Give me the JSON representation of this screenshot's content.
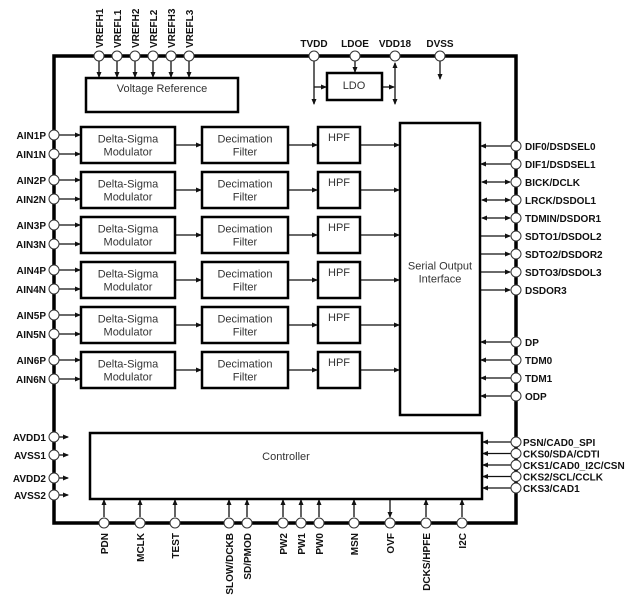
{
  "top_pins": {
    "vref": [
      "VREFH1",
      "VREFL1",
      "VREFH2",
      "VREFL2",
      "VREFH3",
      "VREFL3"
    ],
    "power": [
      "TVDD",
      "LDOE",
      "VDD18",
      "DVSS"
    ]
  },
  "blocks": {
    "voltage_reference": "Voltage Reference",
    "ldo": "LDO",
    "dsm": [
      "Delta-Sigma",
      "Modulator"
    ],
    "decimation": [
      "Decimation",
      "Filter"
    ],
    "hpf": "HPF",
    "serial_output": [
      "Serial Output",
      "Interface"
    ],
    "controller": "Controller"
  },
  "analog_inputs": [
    [
      "AIN1P",
      "AIN1N"
    ],
    [
      "AIN2P",
      "AIN2N"
    ],
    [
      "AIN3P",
      "AIN3N"
    ],
    [
      "AIN4P",
      "AIN4N"
    ],
    [
      "AIN5P",
      "AIN5N"
    ],
    [
      "AIN6P",
      "AIN6N"
    ]
  ],
  "left_power_pins": [
    "AVDD1",
    "AVSS1",
    "AVDD2",
    "AVSS2"
  ],
  "right_pins": [
    {
      "label": "DIF0/DSDSEL0",
      "dir": "in"
    },
    {
      "label": "DIF1/DSDSEL1",
      "dir": "in"
    },
    {
      "label": "BICK/DCLK",
      "dir": "bi"
    },
    {
      "label": "LRCK/DSDOL1",
      "dir": "bi"
    },
    {
      "label": "TDMIN/DSDOR1",
      "dir": "bi"
    },
    {
      "label": "SDTO1/DSDOL2",
      "dir": "out"
    },
    {
      "label": "SDTO2/DSDOR2",
      "dir": "out"
    },
    {
      "label": "SDTO3/DSDOL3",
      "dir": "out"
    },
    {
      "label": "DSDOR3",
      "dir": "out"
    },
    {
      "label": "DP",
      "dir": "in"
    },
    {
      "label": "TDM0",
      "dir": "in"
    },
    {
      "label": "TDM1",
      "dir": "in"
    },
    {
      "label": "ODP",
      "dir": "in"
    }
  ],
  "controller_right_pins": [
    "PSN/CAD0_SPI",
    "CKS0/SDA/CDTI",
    "CKS1/CAD0_I2C/CSN",
    "CKS2/SCL/CCLK",
    "CKS3/CAD1"
  ],
  "bottom_pins": [
    {
      "label": "PDN",
      "dir": "in"
    },
    {
      "label": "MCLK",
      "dir": "in"
    },
    {
      "label": "TEST",
      "dir": "in"
    },
    {
      "label": "SLOW/DCKB",
      "dir": "in"
    },
    {
      "label": "SD/PMOD",
      "dir": "in"
    },
    {
      "label": "PW2",
      "dir": "in"
    },
    {
      "label": "PW1",
      "dir": "in"
    },
    {
      "label": "PW0",
      "dir": "in"
    },
    {
      "label": "MSN",
      "dir": "in"
    },
    {
      "label": "OVF",
      "dir": "out"
    },
    {
      "label": "DCKS/HPFE",
      "dir": "in"
    },
    {
      "label": "I2C",
      "dir": "in"
    }
  ]
}
